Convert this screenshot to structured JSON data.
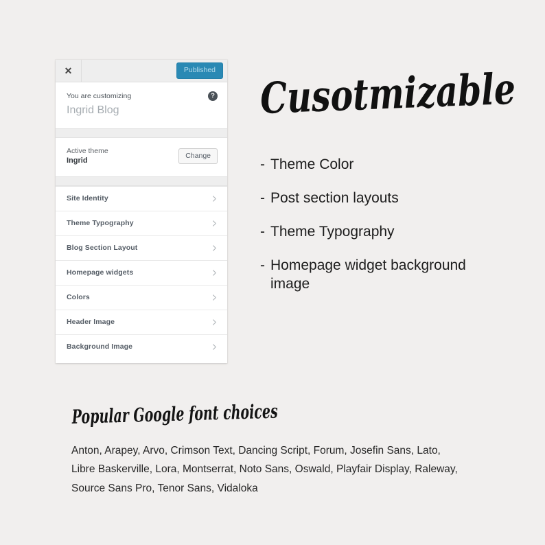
{
  "page": {
    "background_color": "#f1efee"
  },
  "customizer": {
    "topbar": {
      "close_icon": "close-icon",
      "close_glyph": "✕",
      "publish_label": "Published",
      "publish_color": "#2a89b4"
    },
    "customizing": {
      "label": "You are customizing",
      "site_title": "Ingrid Blog",
      "help_icon": "help-icon",
      "help_glyph": "?"
    },
    "theme": {
      "label": "Active theme",
      "name": "Ingrid",
      "change_label": "Change"
    },
    "menu_items": [
      {
        "label": "Site Identity"
      },
      {
        "label": "Theme Typography"
      },
      {
        "label": "Blog Section Layout"
      },
      {
        "label": "Homepage widgets"
      },
      {
        "label": "Colors"
      },
      {
        "label": "Header Image"
      },
      {
        "label": "Background Image"
      }
    ]
  },
  "promo": {
    "headline": "Cusotmizable",
    "features": [
      {
        "dash": "-",
        "text": "Theme Color"
      },
      {
        "dash": "-",
        "text": "Post section layouts"
      },
      {
        "dash": "-",
        "text": "Theme Typography"
      },
      {
        "dash": "-",
        "text": "Homepage widget background image"
      }
    ]
  },
  "fonts_block": {
    "subtitle": "Popular Google font choices",
    "lines": [
      "Anton, Arapey, Arvo, Crimson Text, Dancing Script, Forum, Josefin Sans, Lato,",
      "Libre Baskerville, Lora, Montserrat, Noto Sans, Oswald, Playfair Display, Raleway,",
      "Source Sans Pro, Tenor Sans, Vidaloka"
    ]
  }
}
